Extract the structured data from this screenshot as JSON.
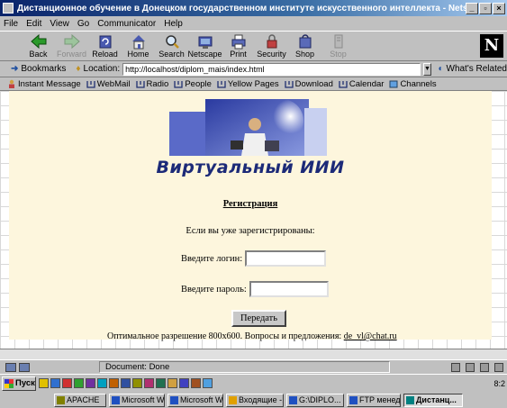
{
  "window": {
    "title": "Дистанционное обучение в Донецком государственном институте искусственного интеллекта - Netscape",
    "buttons": [
      "_",
      "▫",
      "×"
    ]
  },
  "menu": [
    "File",
    "Edit",
    "View",
    "Go",
    "Communicator",
    "Help"
  ],
  "toolbar": [
    {
      "label": "Back",
      "icon": "back-arrow-icon",
      "enabled": true
    },
    {
      "label": "Forward",
      "icon": "forward-arrow-icon",
      "enabled": false
    },
    {
      "label": "Reload",
      "icon": "reload-icon",
      "enabled": true
    },
    {
      "label": "Home",
      "icon": "home-icon",
      "enabled": true
    },
    {
      "label": "Search",
      "icon": "search-icon",
      "enabled": true
    },
    {
      "label": "Netscape",
      "icon": "netscape-icon",
      "enabled": true
    },
    {
      "label": "Print",
      "icon": "print-icon",
      "enabled": true
    },
    {
      "label": "Security",
      "icon": "security-icon",
      "enabled": true
    },
    {
      "label": "Shop",
      "icon": "shop-icon",
      "enabled": true
    },
    {
      "label": "Stop",
      "icon": "stop-icon",
      "enabled": false
    }
  ],
  "location": {
    "bookmarks_label": "Bookmarks",
    "location_label": "Location:",
    "url": "http://localhost/diplom_mais/index.html",
    "related_label": "What's Related"
  },
  "personal_toolbar": [
    "Instant Message",
    "WebMail",
    "Radio",
    "People",
    "Yellow Pages",
    "Download",
    "Calendar",
    "Channels"
  ],
  "page": {
    "site_title": "Виртуальный ИИИ",
    "register_link": "Регистрация",
    "already_registered": "Если вы уже зарегистрированы:",
    "login_label": "Введите логин:",
    "login_value": "",
    "password_label": "Введите пароль:",
    "password_value": "",
    "submit_label": "Передать",
    "footer_prefix": "Оптимальное разрешение 800х600. Вопросы и предложения: ",
    "footer_email": "de_vl@chat.ru"
  },
  "status": {
    "text": "Document: Done"
  },
  "taskbar": {
    "start_label": "Пуск",
    "clock": "8:2",
    "quick_icon_colors": [
      "#e0c000",
      "#3070d0",
      "#d03030",
      "#30a030",
      "#7030a0",
      "#00a0c0",
      "#c06000",
      "#3050a0",
      "#909000",
      "#b03070",
      "#207050",
      "#d0a040",
      "#4040c0",
      "#a05020",
      "#50a0e0"
    ],
    "tasks": [
      {
        "label": "APACHE",
        "active": false,
        "color": "#808000"
      },
      {
        "label": "Microsoft W...",
        "active": false,
        "color": "#2050c0"
      },
      {
        "label": "Microsoft W...",
        "active": false,
        "color": "#2050c0"
      },
      {
        "label": "Входящие -...",
        "active": false,
        "color": "#e0a000"
      },
      {
        "label": "G:\\DIPLO...",
        "active": false,
        "color": "#2050c0"
      },
      {
        "label": "FTP менед...",
        "active": false,
        "color": "#2050c0"
      },
      {
        "label": "Дистанц...",
        "active": true,
        "color": "#008080"
      }
    ]
  }
}
